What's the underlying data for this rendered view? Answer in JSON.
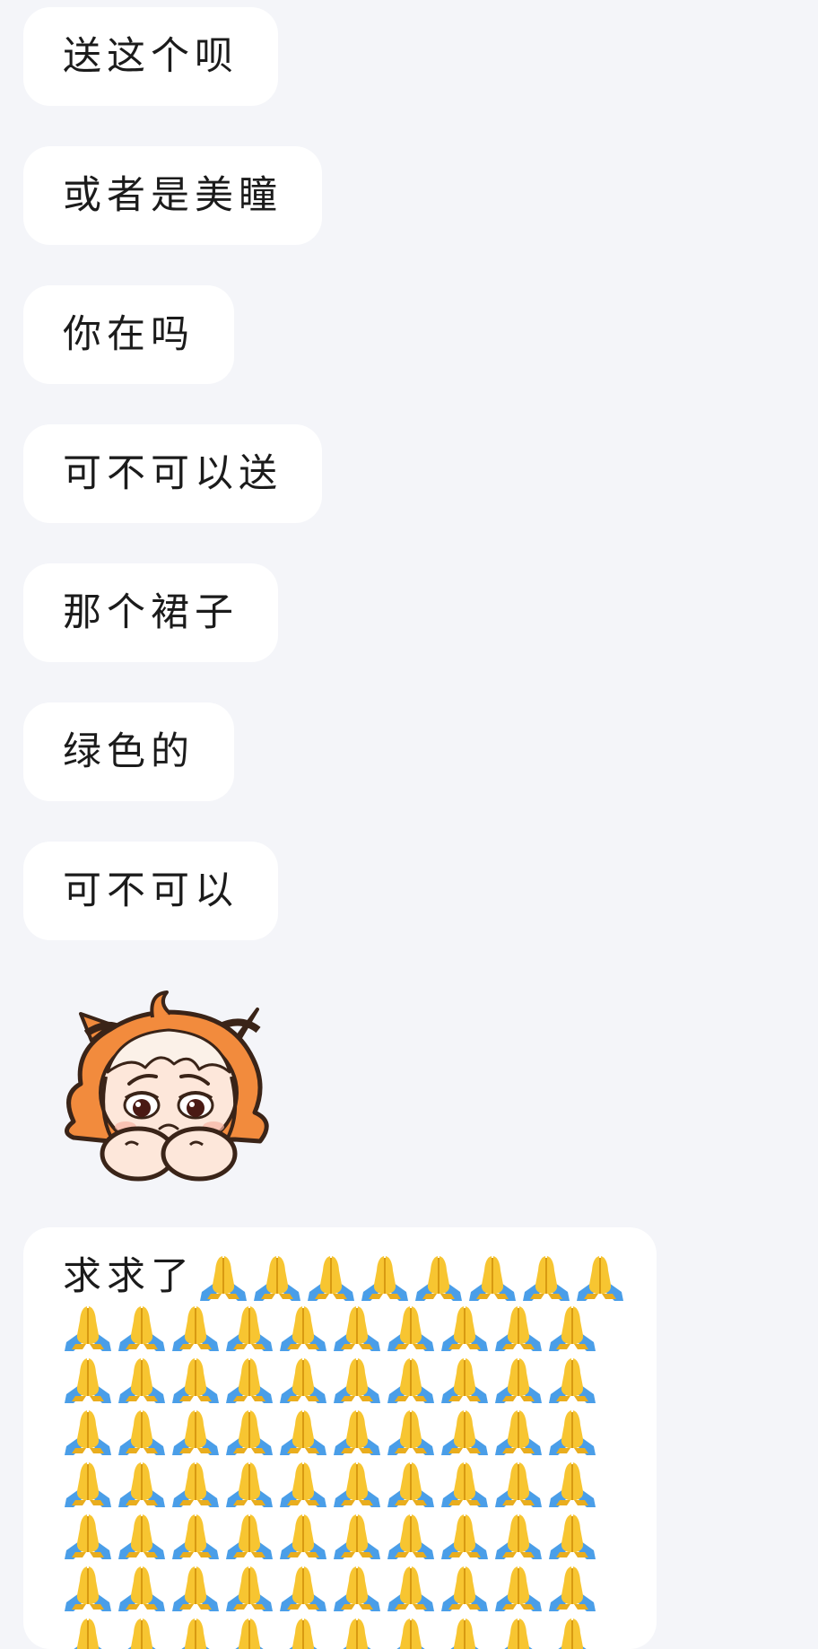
{
  "conversation": {
    "messages": [
      {
        "text": "送这个呗"
      },
      {
        "text": "或者是美瞳"
      },
      {
        "text": "你在吗"
      },
      {
        "text": "可不可以送"
      },
      {
        "text": "那个裙子"
      },
      {
        "text": "绿色的"
      },
      {
        "text": "可不可以"
      }
    ],
    "sticker": {
      "icon": "crying-cartoon-girl-sticker"
    },
    "plead_message": {
      "text": "求求了",
      "emoji": "folded-hands-icon",
      "emoji_char": "🙏"
    }
  },
  "colors": {
    "background": "#f4f5f9",
    "bubble": "#ffffff",
    "text": "#1b1b1b",
    "hand_yellow": "#f7c531",
    "sleeve_blue": "#4a9ee8"
  }
}
